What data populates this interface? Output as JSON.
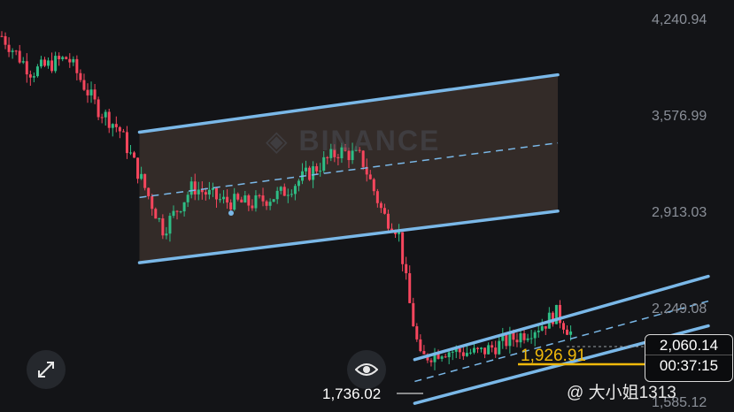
{
  "chart_data": {
    "type": "candlestick",
    "y_axis_labels": [
      "4,240.94",
      "3,576.99",
      "2,913.03",
      "2,249.08",
      "1,585.12"
    ],
    "y_axis_values": [
      4240.94,
      3576.99,
      2913.03,
      2249.08,
      1585.12
    ],
    "current_price": "2,060.14",
    "countdown": "00:37:15",
    "marked_price": "1,926.91",
    "low_label": "1,736.02",
    "channels": [
      {
        "color": "#7ab8e8",
        "upper": [
          [
            0.19,
            3480
          ],
          [
            0.76,
            3880
          ]
        ],
        "lower": [
          [
            0.19,
            2570
          ],
          [
            0.76,
            2930
          ]
        ],
        "fill": "#3a2f2c"
      },
      {
        "color": "#7ab8e8",
        "upper": [
          [
            0.565,
            1895
          ],
          [
            0.965,
            2475
          ]
        ],
        "lower": [
          [
            0.565,
            1590
          ],
          [
            0.965,
            2130
          ]
        ],
        "fill": "none"
      }
    ],
    "colors": {
      "up": "#2ebd85",
      "down": "#f6465d",
      "channel": "#7ab8e8"
    }
  },
  "watermark": "BINANCE",
  "author": "@ 大小姐1313"
}
